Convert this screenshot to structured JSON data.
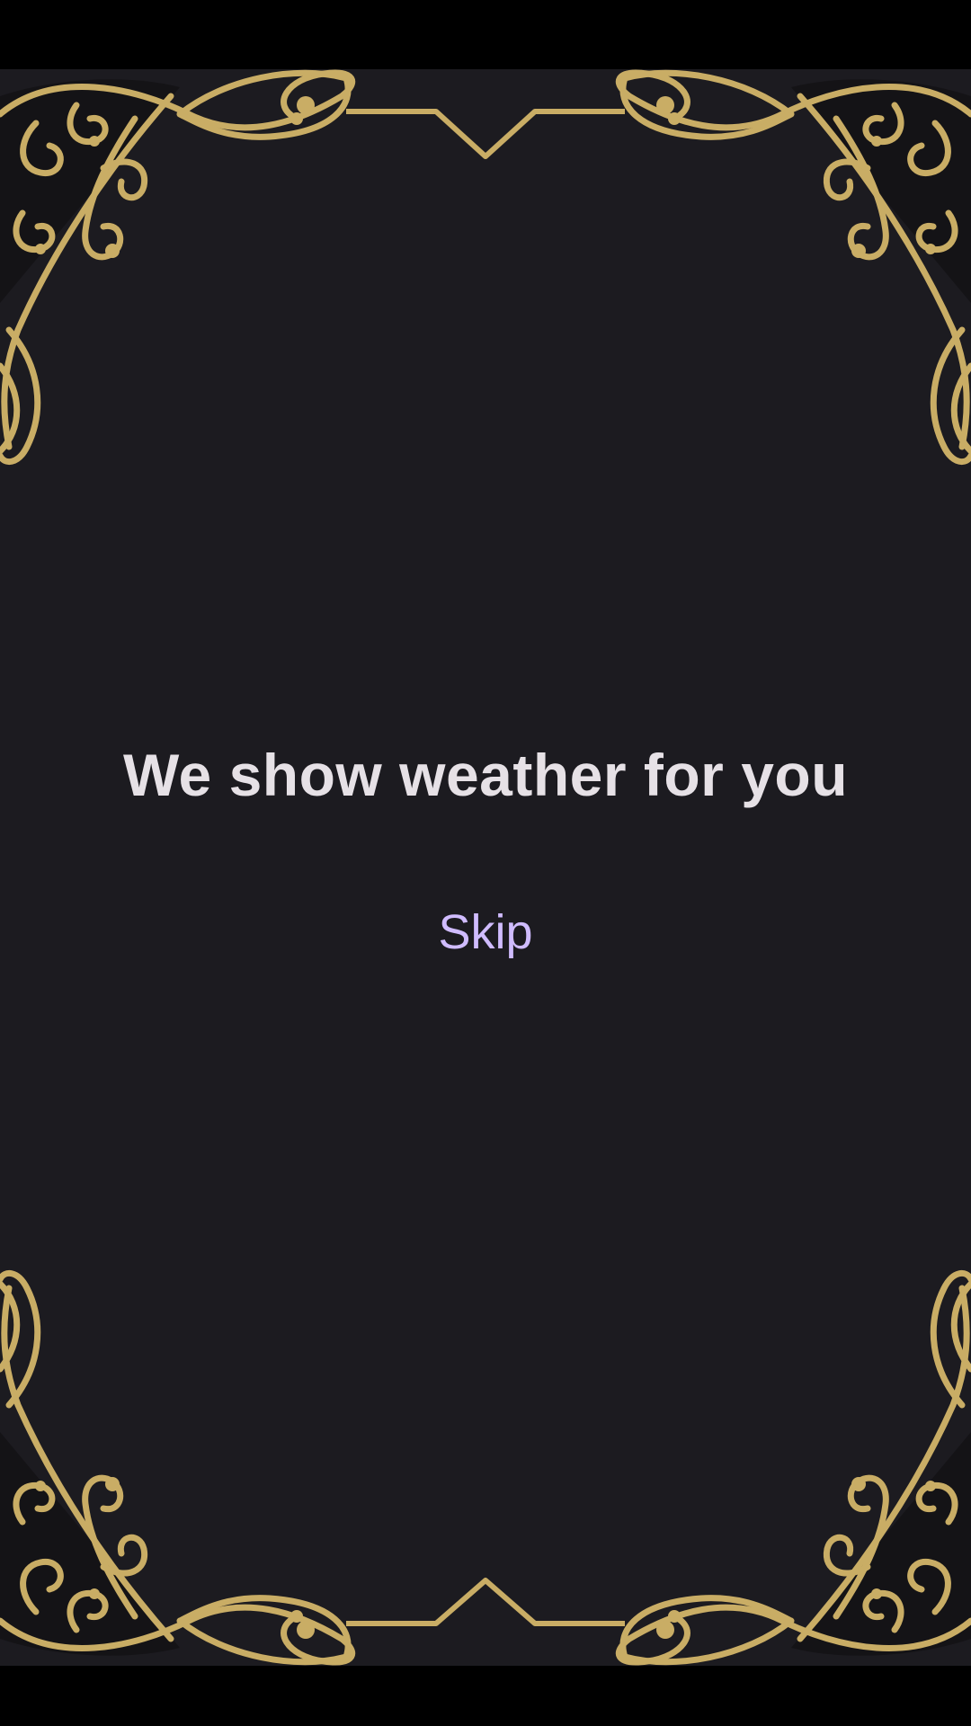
{
  "onboarding": {
    "title": "We show weather for you",
    "skip_label": "Skip"
  },
  "icons": {
    "frame": "ornate-gold-frame-icon"
  },
  "colors": {
    "background": "#1c1b20",
    "system_bars": "#000000",
    "title_text": "#e6e1e6",
    "accent": "#d0bcff",
    "ornament_gold": "#c9ad65"
  }
}
